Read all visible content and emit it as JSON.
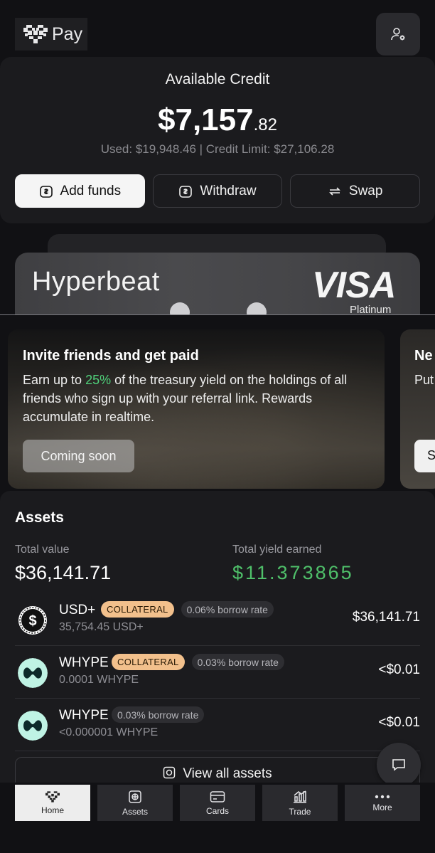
{
  "header": {
    "logo_text": "Pay",
    "settings_icon": "user-settings-icon"
  },
  "credit": {
    "title": "Available Credit",
    "amount_main": "$7,157",
    "amount_cents": ".82",
    "summary": "Used: $19,948.46 | Credit Limit: $27,106.28",
    "actions": [
      {
        "label": "Add funds",
        "icon": "add-funds-icon"
      },
      {
        "label": "Withdraw",
        "icon": "withdraw-icon"
      },
      {
        "label": "Swap",
        "icon": "swap-icon"
      }
    ]
  },
  "card": {
    "brand": "Hyperbeat",
    "network": "VISA",
    "tier": "Platinum"
  },
  "promos": [
    {
      "title": "Invite friends and get paid",
      "body_pre": "Earn up to ",
      "body_highlight": "25%",
      "body_post": " of the treasury yield on the holdings of all friends who sign up with your referral link. Rewards accumulate in realtime.",
      "button": "Coming soon"
    },
    {
      "title": "Ne",
      "body": "Put lifes rate",
      "button": "S"
    }
  ],
  "assets": {
    "title": "Assets",
    "total_value_label": "Total value",
    "total_value": "$36,141.71",
    "yield_label": "Total yield earned",
    "yield_value": "$11.373865",
    "rows": [
      {
        "name": "USD+",
        "collateral": "COLLATERAL",
        "rate": "0.06% borrow rate",
        "qty": "35,754.45 USD+",
        "amount": "$36,141.71",
        "icon": "usd-plus-coin-icon"
      },
      {
        "name": "WHYPE",
        "collateral": "COLLATERAL",
        "rate": "0.03% borrow rate",
        "qty": "0.0001 WHYPE",
        "amount": "<$0.01",
        "icon": "whype-coin-icon"
      },
      {
        "name": "WHYPE",
        "rate": "0.03% borrow rate",
        "qty": "<0.000001 WHYPE",
        "amount": "<$0.01",
        "icon": "whype-coin-icon"
      }
    ],
    "view_all": "View all assets"
  },
  "chat_icon": "chat-bubble-icon",
  "colors": {
    "yield_green": "#4fc06a",
    "highlight_green": "#4fd07a",
    "collateral_badge": "#f2c08c",
    "whype_coin": "#bff3e4"
  },
  "nav": [
    {
      "label": "Home",
      "icon": "heart-home-icon",
      "active": true
    },
    {
      "label": "Assets",
      "icon": "vault-icon"
    },
    {
      "label": "Cards",
      "icon": "card-icon"
    },
    {
      "label": "Trade",
      "icon": "chart-bars-icon"
    },
    {
      "label": "More",
      "icon": "more-dots-icon"
    }
  ]
}
